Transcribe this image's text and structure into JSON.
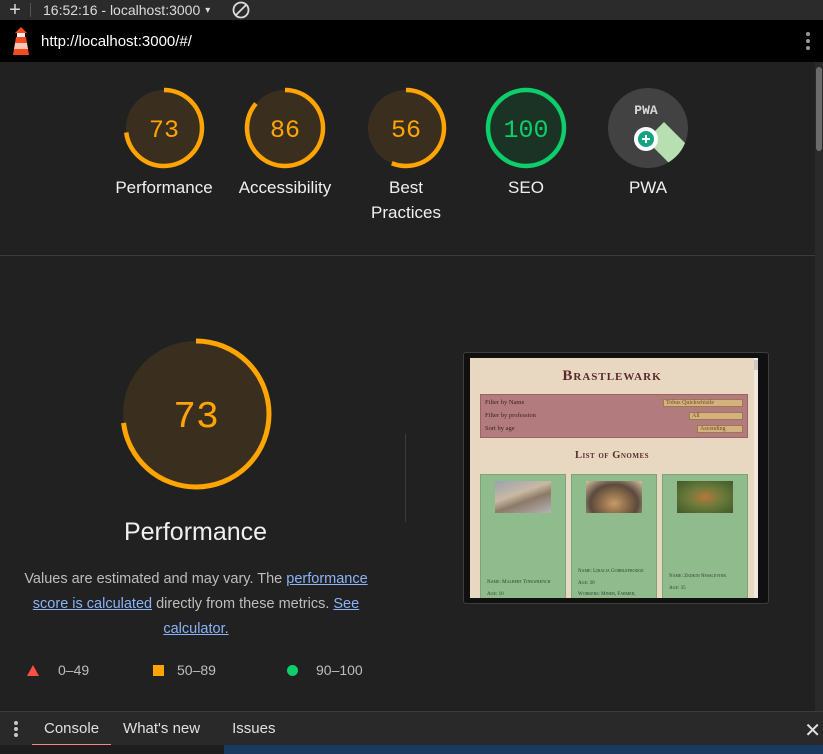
{
  "devtools_bar": {
    "add_label": "+",
    "session_label": "16:52:16 - localhost:3000",
    "caret": "▾"
  },
  "url_bar": {
    "url": "http://localhost:3000/#/"
  },
  "score_gauges": [
    {
      "score": "73",
      "label": "Performance",
      "color": "#ffa400",
      "fraction": 0.73
    },
    {
      "score": "86",
      "label": "Accessibility",
      "color": "#ffa400",
      "fraction": 0.86
    },
    {
      "score": "56",
      "label": "Best Practices",
      "color": "#ffa400",
      "fraction": 0.56
    },
    {
      "score": "100",
      "label": "SEO",
      "color": "#0cce6b",
      "fraction": 1.0
    },
    {
      "score": "",
      "label": "PWA",
      "badge_text": "PWA"
    }
  ],
  "performance": {
    "score": "73",
    "fraction": 0.73,
    "title": "Performance",
    "desc_part1": "Values are estimated and may vary. The ",
    "desc_link1": "performance score is calculated",
    "desc_part2": " directly from these metrics. ",
    "desc_link2": "See calculator."
  },
  "legend": {
    "fail": "0–49",
    "average": "50–89",
    "pass": "90–100"
  },
  "screenshot_preview": {
    "title": "Brastlewark",
    "filter_name_label": "Filter by Name",
    "filter_name_value": "Tobus Quickwhistle",
    "filter_profession_label": "Filter by profession",
    "filter_profession_value": "All",
    "sort_label": "Sort by age",
    "sort_value": "Ascending",
    "list_title": "List of Gnomes",
    "cards": [
      {
        "name": "Name: Malbert Tinkwrench",
        "age": "Age: 10",
        "extra": ""
      },
      {
        "name": "Name: Libalia Gobblefrodge",
        "age": "Age: 30",
        "extra": "Workers: Miner, Farmer,"
      },
      {
        "name": "Name: Zedkin Nesslevink",
        "age": "Age: 35",
        "extra": ""
      }
    ]
  },
  "console_drawer": {
    "tabs": [
      "Console",
      "What's new",
      "Issues"
    ],
    "close": "✕"
  },
  "colors": {
    "average": "#ffa400",
    "pass": "#0cce6b",
    "fail": "#ff4e42",
    "link": "#8ab4f8"
  }
}
